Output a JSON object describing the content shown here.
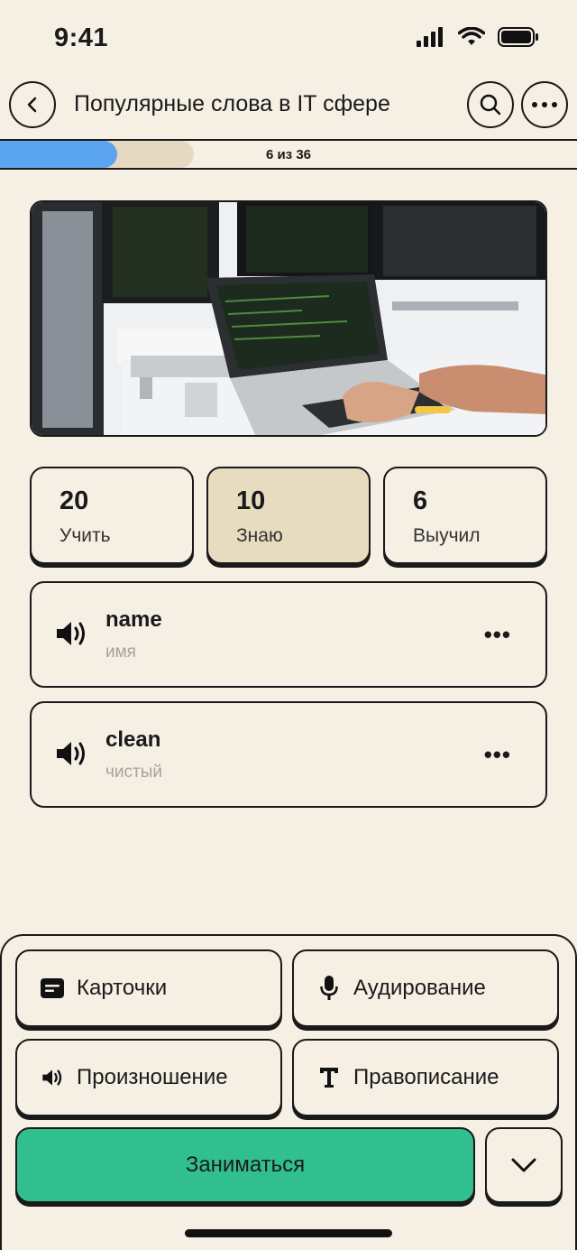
{
  "status_bar": {
    "time": "9:41"
  },
  "header": {
    "title": "Популярные слова в IT сфере"
  },
  "progress": {
    "current": 6,
    "total": 36,
    "text": "6 из 36",
    "fraction": 0.167
  },
  "stats": [
    {
      "count": "20",
      "label": "Учить",
      "active": false
    },
    {
      "count": "10",
      "label": "Знаю",
      "active": true
    },
    {
      "count": "6",
      "label": "Выучил",
      "active": false
    }
  ],
  "words": [
    {
      "word": "name",
      "translation": "имя"
    },
    {
      "word": "clean",
      "translation": "чистый"
    }
  ],
  "modes": {
    "cards": "Карточки",
    "listening": "Аудирование",
    "pronunciation": "Произношение",
    "spelling": "Правописание"
  },
  "primary_action": "Заниматься",
  "colors": {
    "background": "#f5efe4",
    "accent_green": "#31bf8f",
    "progress_blue": "#5aa4f0",
    "active_card": "#e8dcc0"
  },
  "icons": {
    "back": "chevron-left-icon",
    "search": "search-icon",
    "more": "more-horizontal-icon",
    "speaker": "speaker-icon",
    "cards": "card-icon",
    "listening": "microphone-icon",
    "pronunciation": "speaker-icon",
    "spelling": "text-icon",
    "expand": "chevron-down-icon"
  }
}
